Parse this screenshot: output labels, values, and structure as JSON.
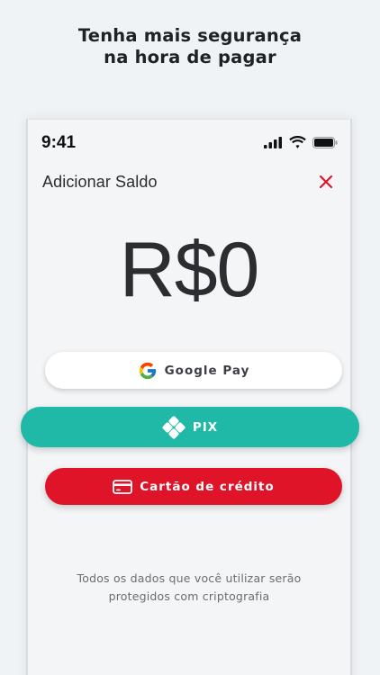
{
  "headline": {
    "line1": "Tenha mais segurança",
    "line2": "na hora de pagar"
  },
  "status_bar": {
    "time": "9:41",
    "icons": [
      "cellular-signal-icon",
      "wifi-icon",
      "battery-icon"
    ]
  },
  "screen": {
    "title": "Adicionar Saldo",
    "close_icon": "close-icon",
    "amount": "R$0"
  },
  "payment_options": {
    "google_pay": {
      "label": "Google Pay",
      "icon": "google-g-icon"
    },
    "pix": {
      "label": "PIX",
      "icon": "pix-icon"
    },
    "credit_card": {
      "label": "Cartão de crédito",
      "icon": "credit-card-icon"
    }
  },
  "footnote": {
    "line1": "Todos os dados que você utilizar serão",
    "line2": "protegidos com criptografia"
  },
  "colors": {
    "background": "#f0f3f6",
    "pix_teal": "#20b8a6",
    "card_red": "#df1428",
    "close_red": "#df1428"
  }
}
